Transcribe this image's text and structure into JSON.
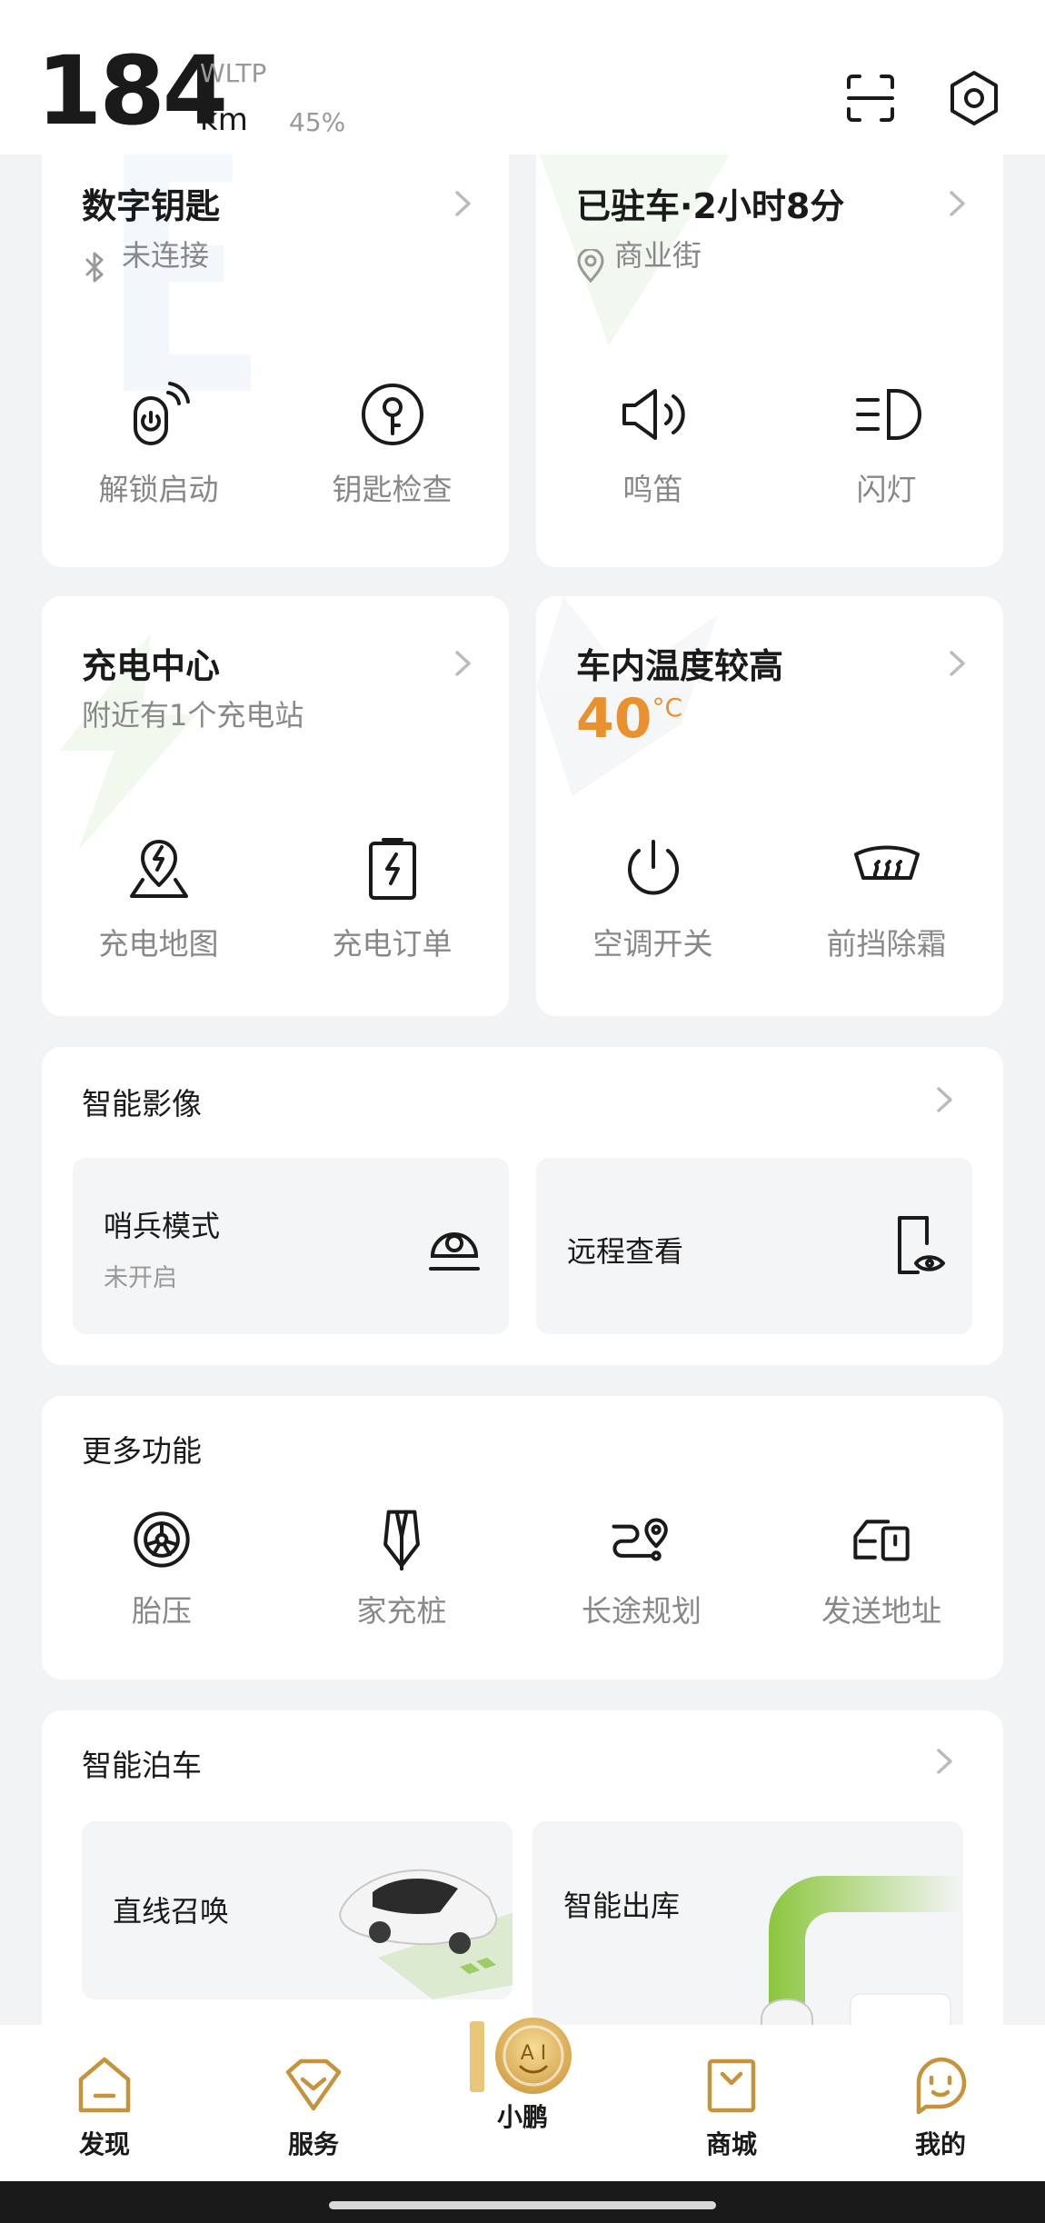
{
  "header": {
    "range_value": "184",
    "range_standard": "WLTP",
    "range_unit": "km",
    "battery_percent": "45%",
    "scan_icon": "scan-icon",
    "settings_icon": "settings-icon"
  },
  "digital_key": {
    "title": "数字钥匙",
    "status": "未连接",
    "actions": [
      {
        "label": "解锁启动",
        "icon": "unlock-start-icon"
      },
      {
        "label": "钥匙检查",
        "icon": "key-check-icon"
      }
    ]
  },
  "parking": {
    "title": "已驻车·2小时8分",
    "location": "商业街",
    "actions": [
      {
        "label": "鸣笛",
        "icon": "horn-icon"
      },
      {
        "label": "闪灯",
        "icon": "flash-lights-icon"
      }
    ]
  },
  "charging": {
    "title": "充电中心",
    "subtitle": "附近有1个充电站",
    "actions": [
      {
        "label": "充电地图",
        "icon": "charging-map-icon"
      },
      {
        "label": "充电订单",
        "icon": "charging-order-icon"
      }
    ]
  },
  "cabin": {
    "title": "车内温度较高",
    "temperature": "40",
    "temp_unit": "°C",
    "accent_color": "#e8912e",
    "actions": [
      {
        "label": "空调开关",
        "icon": "power-icon"
      },
      {
        "label": "前挡除霜",
        "icon": "defrost-icon"
      }
    ]
  },
  "smart_camera": {
    "title": "智能影像",
    "tiles": [
      {
        "title": "哨兵模式",
        "subtitle": "未开启",
        "icon": "sentinel-camera-icon"
      },
      {
        "title": "远程查看",
        "icon": "remote-view-icon"
      }
    ]
  },
  "more_functions": {
    "title": "更多功能",
    "items": [
      {
        "label": "胎压",
        "icon": "tire-icon"
      },
      {
        "label": "家充桩",
        "icon": "home-charger-icon"
      },
      {
        "label": "长途规划",
        "icon": "route-plan-icon"
      },
      {
        "label": "发送地址",
        "icon": "send-address-icon"
      }
    ]
  },
  "smart_parking": {
    "title": "智能泊车",
    "tiles": [
      {
        "title": "直线召唤"
      },
      {
        "title": "智能出库"
      }
    ],
    "accent_color": "#8cc63f"
  },
  "bottom_nav": {
    "items": [
      {
        "label": "发现",
        "icon": "home-icon"
      },
      {
        "label": "服务",
        "icon": "service-icon"
      },
      {
        "label": "小鹏",
        "icon": "ai-assistant-icon"
      },
      {
        "label": "商城",
        "icon": "shop-bag-icon"
      },
      {
        "label": "我的",
        "icon": "profile-face-icon"
      }
    ],
    "brand_gold": "#d8a84a"
  }
}
